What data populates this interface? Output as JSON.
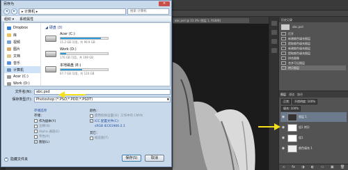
{
  "colors": {
    "accent": "#2c9ad9",
    "arrow": "#f5e01a",
    "link": "#1e4c9c"
  },
  "dialog": {
    "title": "另存为",
    "close_label": "✕",
    "address": "▸ 计算机 ▸",
    "search_placeholder": "搜索 计算机",
    "toolbar": {
      "organize": "组织 ▾",
      "properties": "系统属性"
    },
    "nav": [
      {
        "label": "Dropbox",
        "icon": "dropbox-icon",
        "color": "#2f7fd6"
      },
      {
        "label": "库",
        "icon": "library-icon",
        "color": "#e9c35b"
      },
      {
        "label": "视频",
        "icon": "video-icon",
        "color": "#7aa0cf"
      },
      {
        "label": "图片",
        "icon": "picture-icon",
        "color": "#d9a96a"
      },
      {
        "label": "文档",
        "icon": "document-icon",
        "color": "#d9c68a"
      },
      {
        "label": "音乐",
        "icon": "music-icon",
        "color": "#5b8fd6"
      },
      {
        "label": "计算机",
        "icon": "computer-icon",
        "color": "#6b8fb8"
      },
      {
        "label": "Acer (C:)",
        "icon": "drive-icon",
        "color": "#999999"
      },
      {
        "label": "Work (D:)",
        "icon": "drive-icon",
        "color": "#999999"
      }
    ],
    "group_label": "硬盘 (3)",
    "drives": [
      {
        "name": "Acer (C:)",
        "free": "15.2 GB 可用，共 99.9 GB",
        "used_fraction": 0.85
      },
      {
        "name": "Work (D:)",
        "free": "176 GB 可用，共 199 GB",
        "used_fraction": 0.12
      },
      {
        "name": "本地磁盘 (E:)",
        "free": "67.7 GB 可用，共 124 GB",
        "used_fraction": 0.45
      }
    ],
    "filename_label": "文件名(N):",
    "filename_value": "abc.psd",
    "format_label": "保存类型(T):",
    "format_value": "Photoshop (*.PSD;*.PDD;*.PSDT)",
    "options": {
      "storage_header": "存储选项",
      "storage_sub": "存储：",
      "as_copy": "作为副本(Y)",
      "notes": "注释(N)",
      "alpha": "Alpha 通道(E)",
      "spot": "专色(P)",
      "layers": "图层(L)",
      "color_header": "颜色：",
      "use_proof": "使用校样设置(O): 工作中的 CMYK",
      "icc": "ICC 配置文件(C):",
      "icc_value": "sRGB IEC61966-2.1",
      "other_header": "其它：",
      "thumbnail": "缩览图(T)"
    },
    "hide_folders": "隐藏文件夹",
    "save_button": "保存(S)",
    "cancel_button": "取消"
  },
  "photoshop": {
    "doc_tab": "abc.psd @ 33.3% (图层 1, RGB/8)",
    "history": {
      "header": "历史记录",
      "snapshot": "abc.psd",
      "items": [
        "打开",
        "新建颜色填充图层",
        "提取颜色填充图层",
        "新建颜色填充图层",
        "提取颜色填充图层",
        "拼合图像",
        "合并可见图层",
        "拷贝图层"
      ]
    },
    "layers": {
      "tabs": [
        "图层",
        "通道",
        "路径"
      ],
      "mode": "正常",
      "opacity_label": "不透明度: 100%",
      "fill_label": "填充: 100%",
      "rows": [
        {
          "name": "图层 1"
        },
        {
          "name": "组1 拷贝"
        },
        {
          "name": "组1"
        },
        {
          "name": "颜色填充 1"
        }
      ],
      "bottom_icons": [
        "∞",
        "fx",
        "◑",
        "◐",
        "▭",
        "▣",
        "🗑"
      ]
    }
  }
}
